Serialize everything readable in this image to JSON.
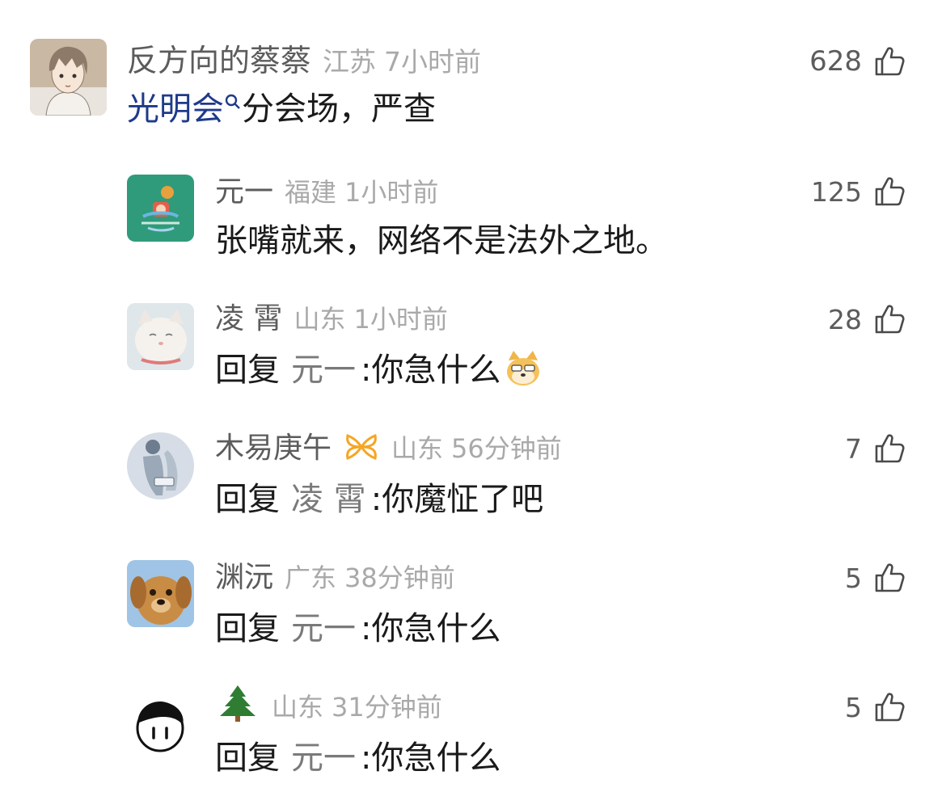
{
  "main_comment": {
    "username": "反方向的蔡蔡",
    "location": "江苏",
    "time": "7小时前",
    "likes": "628",
    "topic": "光明会",
    "text_after_topic": "分会场，严查"
  },
  "replies": [
    {
      "username": "元一",
      "location": "福建",
      "time": "1小时前",
      "likes": "125",
      "text": "张嘴就来，网络不是法外之地。"
    },
    {
      "username": "凌 霄",
      "location": "山东",
      "time": "1小时前",
      "likes": "28",
      "reply_label": "回复",
      "reply_target": "元一",
      "text": ":你急什么"
    },
    {
      "username": "木易庚午",
      "location": "山东",
      "time": "56分钟前",
      "likes": "7",
      "reply_label": "回复",
      "reply_target": "凌 霄",
      "text": ":你魔怔了吧"
    },
    {
      "username": "渊沅",
      "location": "广东",
      "time": "38分钟前",
      "likes": "5",
      "reply_label": "回复",
      "reply_target": "元一",
      "text": ":你急什么"
    },
    {
      "username": "",
      "location": "山东",
      "time": "31分钟前",
      "likes": "5",
      "reply_label": "回复",
      "reply_target": "元一",
      "text": ":你急什么"
    }
  ],
  "icons": {
    "like": "thumbs-up-icon",
    "search": "search-icon",
    "emoji": "doge-emoji-icon",
    "vip": "vip-badge-icon",
    "tree": "tree-emoji-icon"
  },
  "colors": {
    "topic_link": "#1e3a8a",
    "meta_gray": "#a9a9a9",
    "name_gray": "#5c5c5c",
    "text": "#1a1a1a",
    "vip_orange": "#f5a623"
  }
}
